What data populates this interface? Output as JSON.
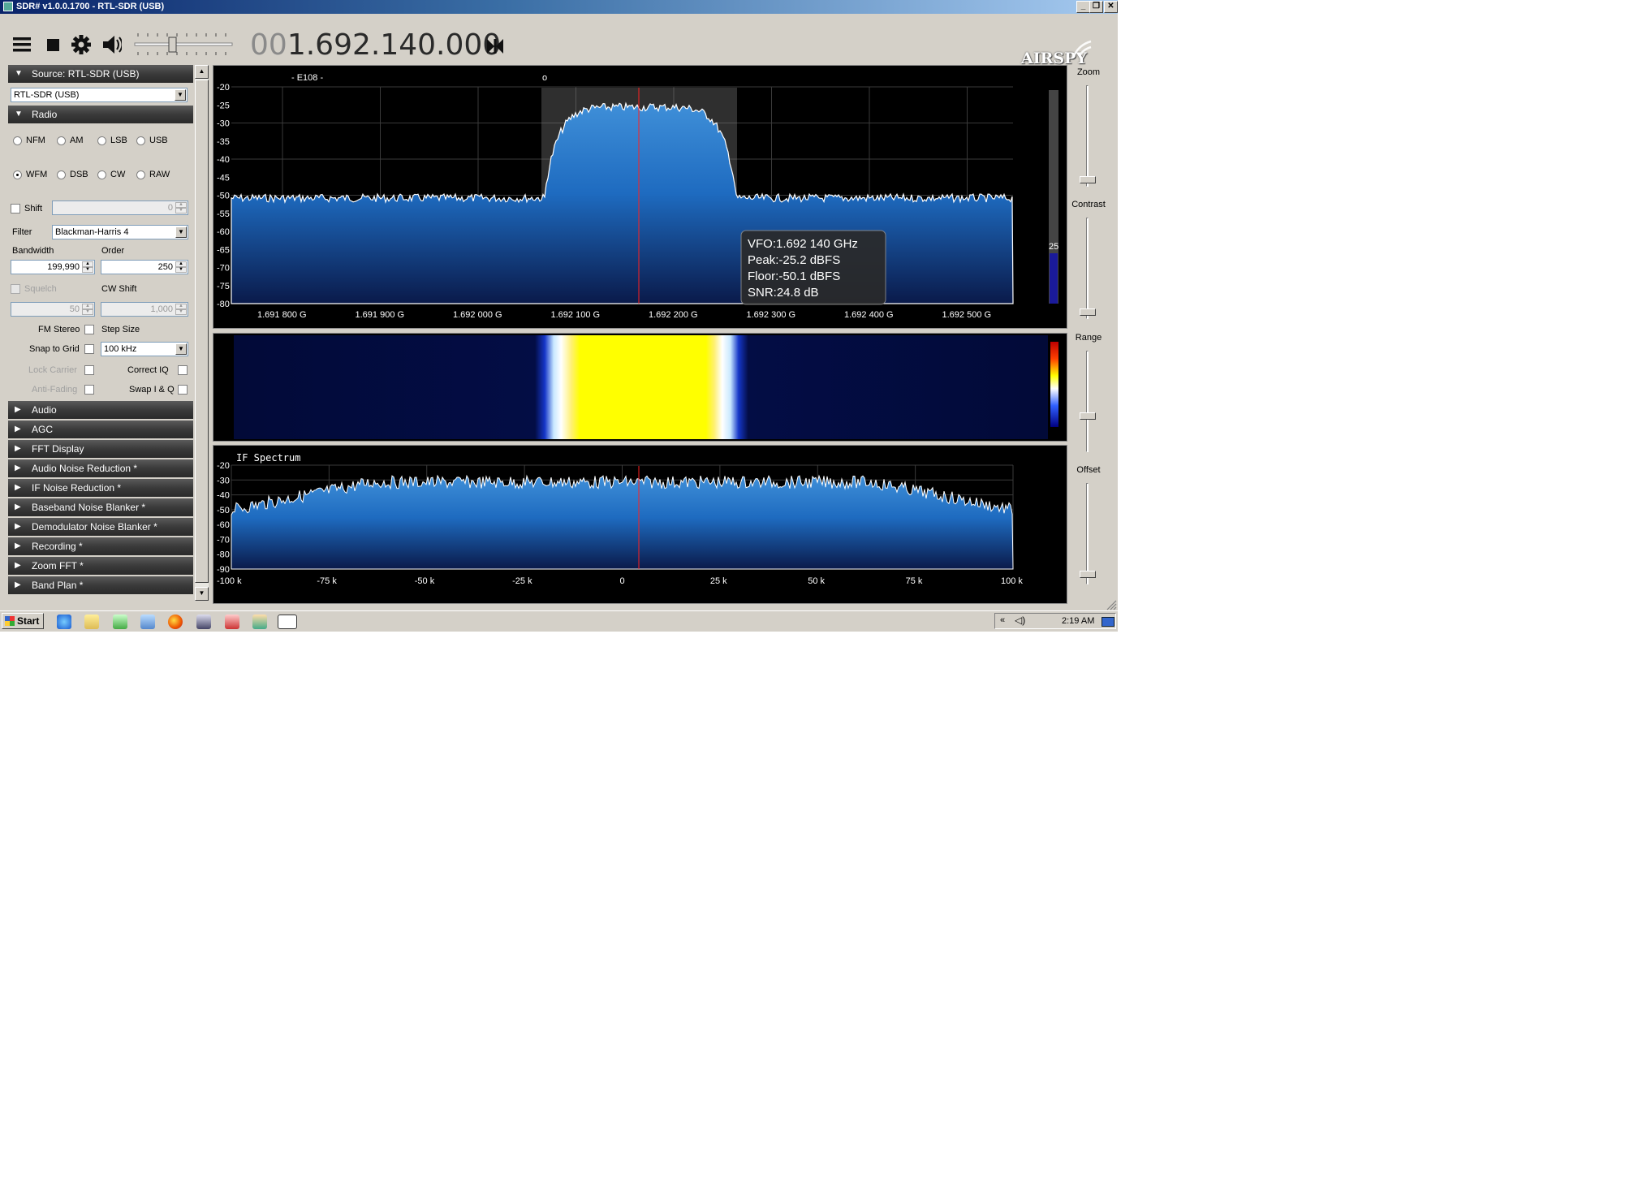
{
  "window": {
    "title": "SDR# v1.0.0.1700 - RTL-SDR (USB)",
    "controls": [
      "_",
      "❐",
      "✕"
    ]
  },
  "toolbar": {
    "menu_icon": "hamburger-menu-icon",
    "stop_icon": "stop-icon",
    "settings_icon": "gear-icon",
    "audio_icon": "speaker-icon",
    "frequency_dim": "00",
    "frequency": "1.692.140.000",
    "tuning_icon": "tune-step-icon",
    "volume_fraction": 0.4,
    "logo": "AIRSPY"
  },
  "source": {
    "header": "Source: RTL-SDR (USB)",
    "device": "RTL-SDR (USB)"
  },
  "radio": {
    "header": "Radio",
    "modes_row1": [
      "NFM",
      "AM",
      "LSB",
      "USB"
    ],
    "modes_row2": [
      "WFM",
      "DSB",
      "CW",
      "RAW"
    ],
    "selected_mode": "WFM",
    "shift_label": "Shift",
    "shift_value": "0",
    "filter_label": "Filter",
    "filter_value": "Blackman-Harris 4",
    "bandwidth_label": "Bandwidth",
    "bandwidth_value": "199,990",
    "order_label": "Order",
    "order_value": "250",
    "squelch_label": "Squelch",
    "squelch_value": "50",
    "cwshift_label": "CW Shift",
    "cwshift_value": "1,000",
    "fmstereo_label": "FM Stereo",
    "stepsize_label": "Step Size",
    "snap_label": "Snap to Grid",
    "step_value": "100 kHz",
    "lockcarrier_label": "Lock Carrier",
    "correctiq_label": "Correct IQ",
    "antifading_label": "Anti-Fading",
    "swapiq_label": "Swap I & Q"
  },
  "sections": [
    "Audio",
    "AGC",
    "FFT Display",
    "Audio Noise Reduction *",
    "IF Noise Reduction *",
    "Baseband Noise Blanker *",
    "Demodulator Noise Blanker *",
    "Recording *",
    "Zoom FFT *",
    "Band Plan *"
  ],
  "spectrum": {
    "station_label": "- E108 -",
    "marker_label": "o",
    "db_ticks": [
      "-20",
      "-25",
      "-30",
      "-35",
      "-40",
      "-45",
      "-50",
      "-55",
      "-60",
      "-65",
      "-70",
      "-75",
      "-80"
    ],
    "freq_ticks": [
      "1.691 800 G",
      "1.691 900 G",
      "1.692 000 G",
      "1.692 100 G",
      "1.692 200 G",
      "1.692 300 G",
      "1.692 400 G",
      "1.692 500 G"
    ],
    "snr_value": "25",
    "tooltip": {
      "vfo": "VFO:1.692 140 GHz",
      "peak": "Peak:-25.2 dBFS",
      "floor": "Floor:-50.1 dBFS",
      "snr": "SNR:24.8 dB"
    }
  },
  "if_spectrum": {
    "title": "IF Spectrum",
    "db_ticks": [
      "-20",
      "-30",
      "-40",
      "-50",
      "-60",
      "-70",
      "-80",
      "-90"
    ],
    "freq_ticks": [
      "-100 k",
      "-75 k",
      "-50 k",
      "-25 k",
      "0",
      "25 k",
      "50 k",
      "75 k",
      "100 k"
    ]
  },
  "right_controls": [
    "Zoom",
    "Contrast",
    "Range",
    "Offset"
  ],
  "taskbar": {
    "start": "Start",
    "clock": "2:19 AM",
    "apps": [
      "ie-icon",
      "folder-icon",
      "task-manager-icon",
      "network-icon",
      "firefox-icon",
      "search-icon",
      "toolbox-icon",
      "paint-icon",
      "sdrsharp-icon"
    ]
  }
}
